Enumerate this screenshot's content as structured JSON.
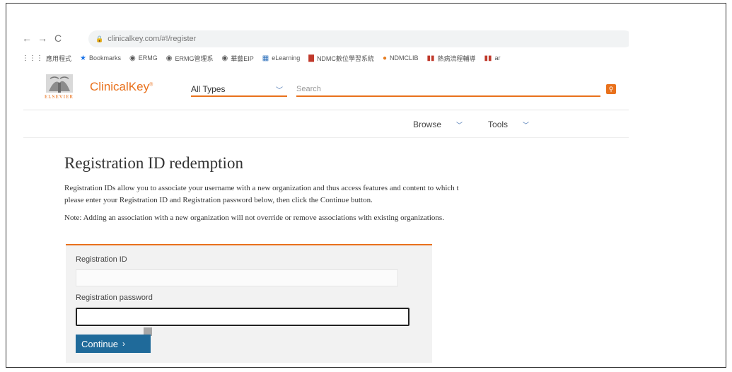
{
  "browser": {
    "url": "clinicalkey.com/#!/register",
    "bookmarks": [
      {
        "label": "應用程式",
        "icon": "apps-grid-icon",
        "color": "#555555"
      },
      {
        "label": "Bookmarks",
        "icon": "star-icon",
        "color": "#1a73e8"
      },
      {
        "label": "ERMG",
        "icon": "globe-icon",
        "color": "#444444"
      },
      {
        "label": "ERMG管理系",
        "icon": "globe-icon",
        "color": "#444444"
      },
      {
        "label": "華藝EIP",
        "icon": "globe-icon",
        "color": "#444444"
      },
      {
        "label": "eLearning",
        "icon": "blue-grid-icon",
        "color": "#2a6ebb"
      },
      {
        "label": "NDMC數位學習系統",
        "icon": "red-book-icon",
        "color": "#c0392b"
      },
      {
        "label": "NDMCLIB",
        "icon": "orange-dot-icon",
        "color": "#e67e22"
      },
      {
        "label": "熱病流程輔導",
        "icon": "red-badge-icon",
        "color": "#c0392b"
      },
      {
        "label": "ar",
        "icon": "red-badge-icon",
        "color": "#c0392b"
      }
    ]
  },
  "header": {
    "brand": "ClinicalKey",
    "brand_mark": "®",
    "publisher": "ELSEVIER",
    "type_select": "All Types",
    "search_placeholder": "Search",
    "accent": "#e9711c"
  },
  "menu": {
    "browse": "Browse",
    "tools": "Tools"
  },
  "main": {
    "title": "Registration ID redemption",
    "paragraph": "Registration IDs allow you to associate your username with a new organization and thus access features and content to which t",
    "paragraph_line2": "please enter your Registration ID and Registration password below, then click the Continue button.",
    "note": "Note: Adding an association with a new organization will not override or remove associations with existing organizations."
  },
  "form": {
    "id_label": "Registration ID",
    "id_value": "",
    "password_label": "Registration password",
    "password_value": "",
    "continue_label": "Continue",
    "button_color": "#1f6a9a"
  }
}
